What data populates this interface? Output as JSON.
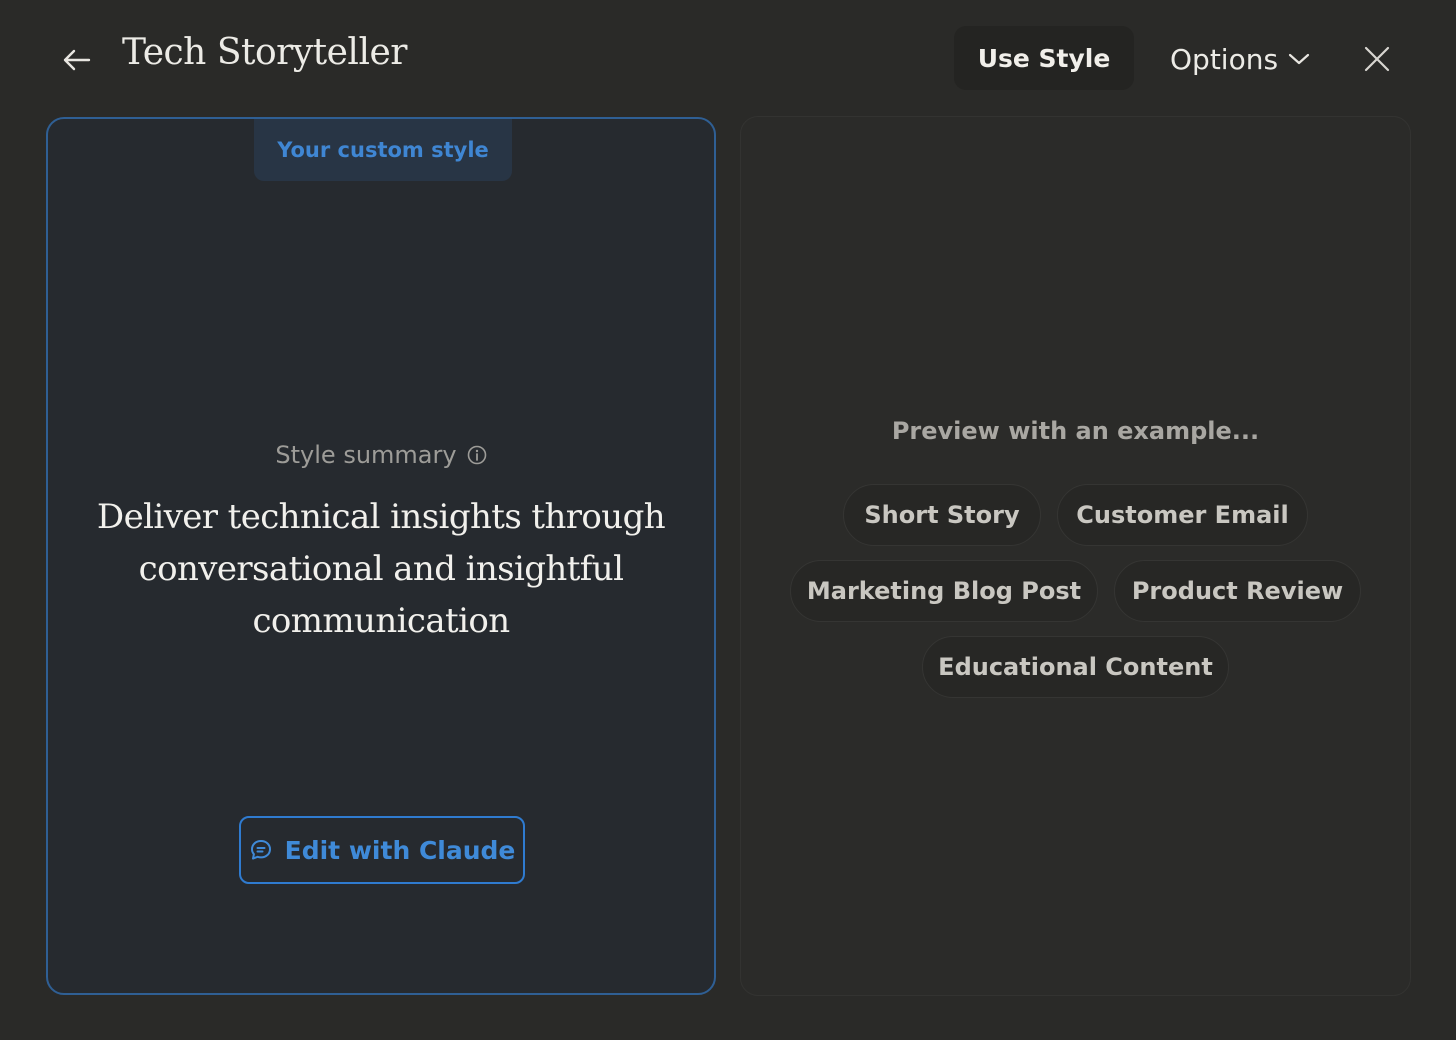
{
  "header": {
    "back_icon": "arrow-left-icon",
    "title": "Tech Storyteller",
    "use_style_label": "Use Style",
    "options_label": "Options",
    "options_icon": "chevron-down-icon",
    "close_icon": "close-icon"
  },
  "style_panel": {
    "tag_label": "Your custom style",
    "summary_label": "Style summary",
    "info_icon": "info-icon",
    "summary_text": "Deliver technical insights through conversational and insightful communication",
    "edit_label": "Edit with Claude",
    "edit_icon": "chat-bubble-icon"
  },
  "preview_panel": {
    "label": "Preview with an example...",
    "examples": [
      "Short Story",
      "Customer Email",
      "Marketing Blog Post",
      "Product Review",
      "Educational Content"
    ]
  },
  "colors": {
    "background": "#2a2a28",
    "accent_blue": "#3f86d3",
    "panel_border_blue": "#2f5f94"
  }
}
